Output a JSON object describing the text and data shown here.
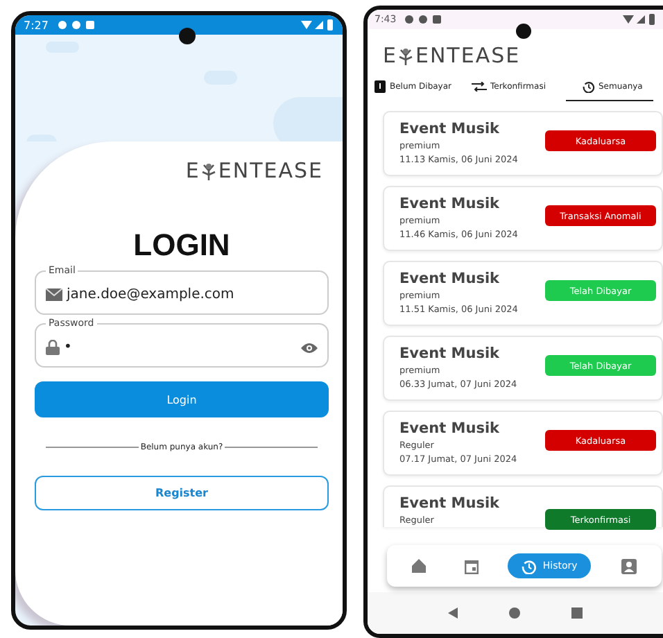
{
  "login_phone": {
    "status_bar": {
      "time": "7:27"
    },
    "logo": {
      "before": "E",
      "after": "ENTEASE"
    },
    "title": "LOGIN",
    "email": {
      "label": "Email",
      "value": "jane.doe@example.com"
    },
    "password": {
      "label": "Password",
      "value": "•"
    },
    "login_button": "Login",
    "divider_text": "Belum punya akun?",
    "register_button": "Register"
  },
  "history_phone": {
    "status_bar": {
      "time": "7:43"
    },
    "logo": {
      "before": "E",
      "after": "ENTEASE"
    },
    "tabs": [
      {
        "label": "Belum Dibayar",
        "kind": "unpaid",
        "selected": false
      },
      {
        "label": "Terkonfirmasi",
        "kind": "confirmed",
        "selected": false
      },
      {
        "label": "Semuanya",
        "kind": "all",
        "selected": true
      }
    ],
    "events": [
      {
        "name": "Event Musik",
        "ticket": "premium",
        "date": "11.13 Kamis, 06 Juni 2024",
        "status": "Kadaluarsa",
        "color": "#d40000"
      },
      {
        "name": "Event Musik",
        "ticket": "premium",
        "date": "11.46 Kamis, 06 Juni 2024",
        "status": "Transaksi Anomali",
        "color": "#d40000"
      },
      {
        "name": "Event Musik",
        "ticket": "premium",
        "date": "11.51 Kamis, 06 Juni 2024",
        "status": "Telah Dibayar",
        "color": "#1ecb4f"
      },
      {
        "name": "Event Musik",
        "ticket": "premium",
        "date": "06.33 Jumat, 07 Juni 2024",
        "status": "Telah Dibayar",
        "color": "#1ecb4f"
      },
      {
        "name": "Event Musik",
        "ticket": "Reguler",
        "date": "07.17 Jumat, 07 Juni 2024",
        "status": "Kadaluarsa",
        "color": "#d40000"
      },
      {
        "name": "Event Musik",
        "ticket": "Reguler",
        "status": "Terkonfirmasi",
        "color": "#0e7a2a"
      }
    ],
    "bottom_nav": [
      {
        "kind": "home",
        "selected": false
      },
      {
        "kind": "calendar",
        "selected": false
      },
      {
        "kind": "history",
        "label": "History",
        "selected": true
      },
      {
        "kind": "profile",
        "selected": false
      }
    ]
  }
}
